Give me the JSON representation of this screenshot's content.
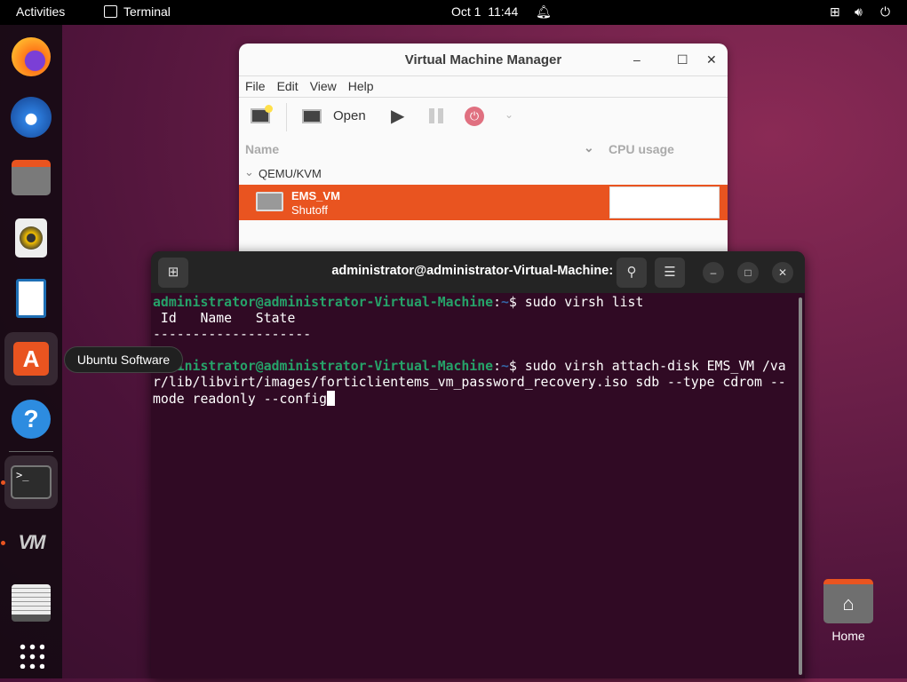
{
  "topbar": {
    "activities": "Activities",
    "app": "Terminal",
    "clock": "Oct 1  11:44"
  },
  "dock": {
    "tooltip": "Ubuntu Software"
  },
  "vmm": {
    "title": "Virtual Machine Manager",
    "menu": [
      "File",
      "Edit",
      "View",
      "Help"
    ],
    "open_label": "Open",
    "columns": {
      "name": "Name",
      "cpu": "CPU usage"
    },
    "group": "QEMU/KVM",
    "vm": {
      "name": "EMS_VM",
      "state": "Shutoff"
    }
  },
  "terminal": {
    "title": "administrator@administrator-Virtual-Machine: ~",
    "prompt_user": "administrator@administrator-Virtual-Machine",
    "prompt_path": "~",
    "line1_cmd": "$ sudo virsh list",
    "line2": " Id   Name   State",
    "line3": "--------------------",
    "line5_cmd": "$ sudo virsh attach-disk EMS_VM /va",
    "line6": "r/lib/libvirt/images/forticlientems_vm_password_recovery.iso sdb --type cdrom --",
    "line7": "mode readonly --config"
  },
  "desktop": {
    "home_label": "Home"
  }
}
